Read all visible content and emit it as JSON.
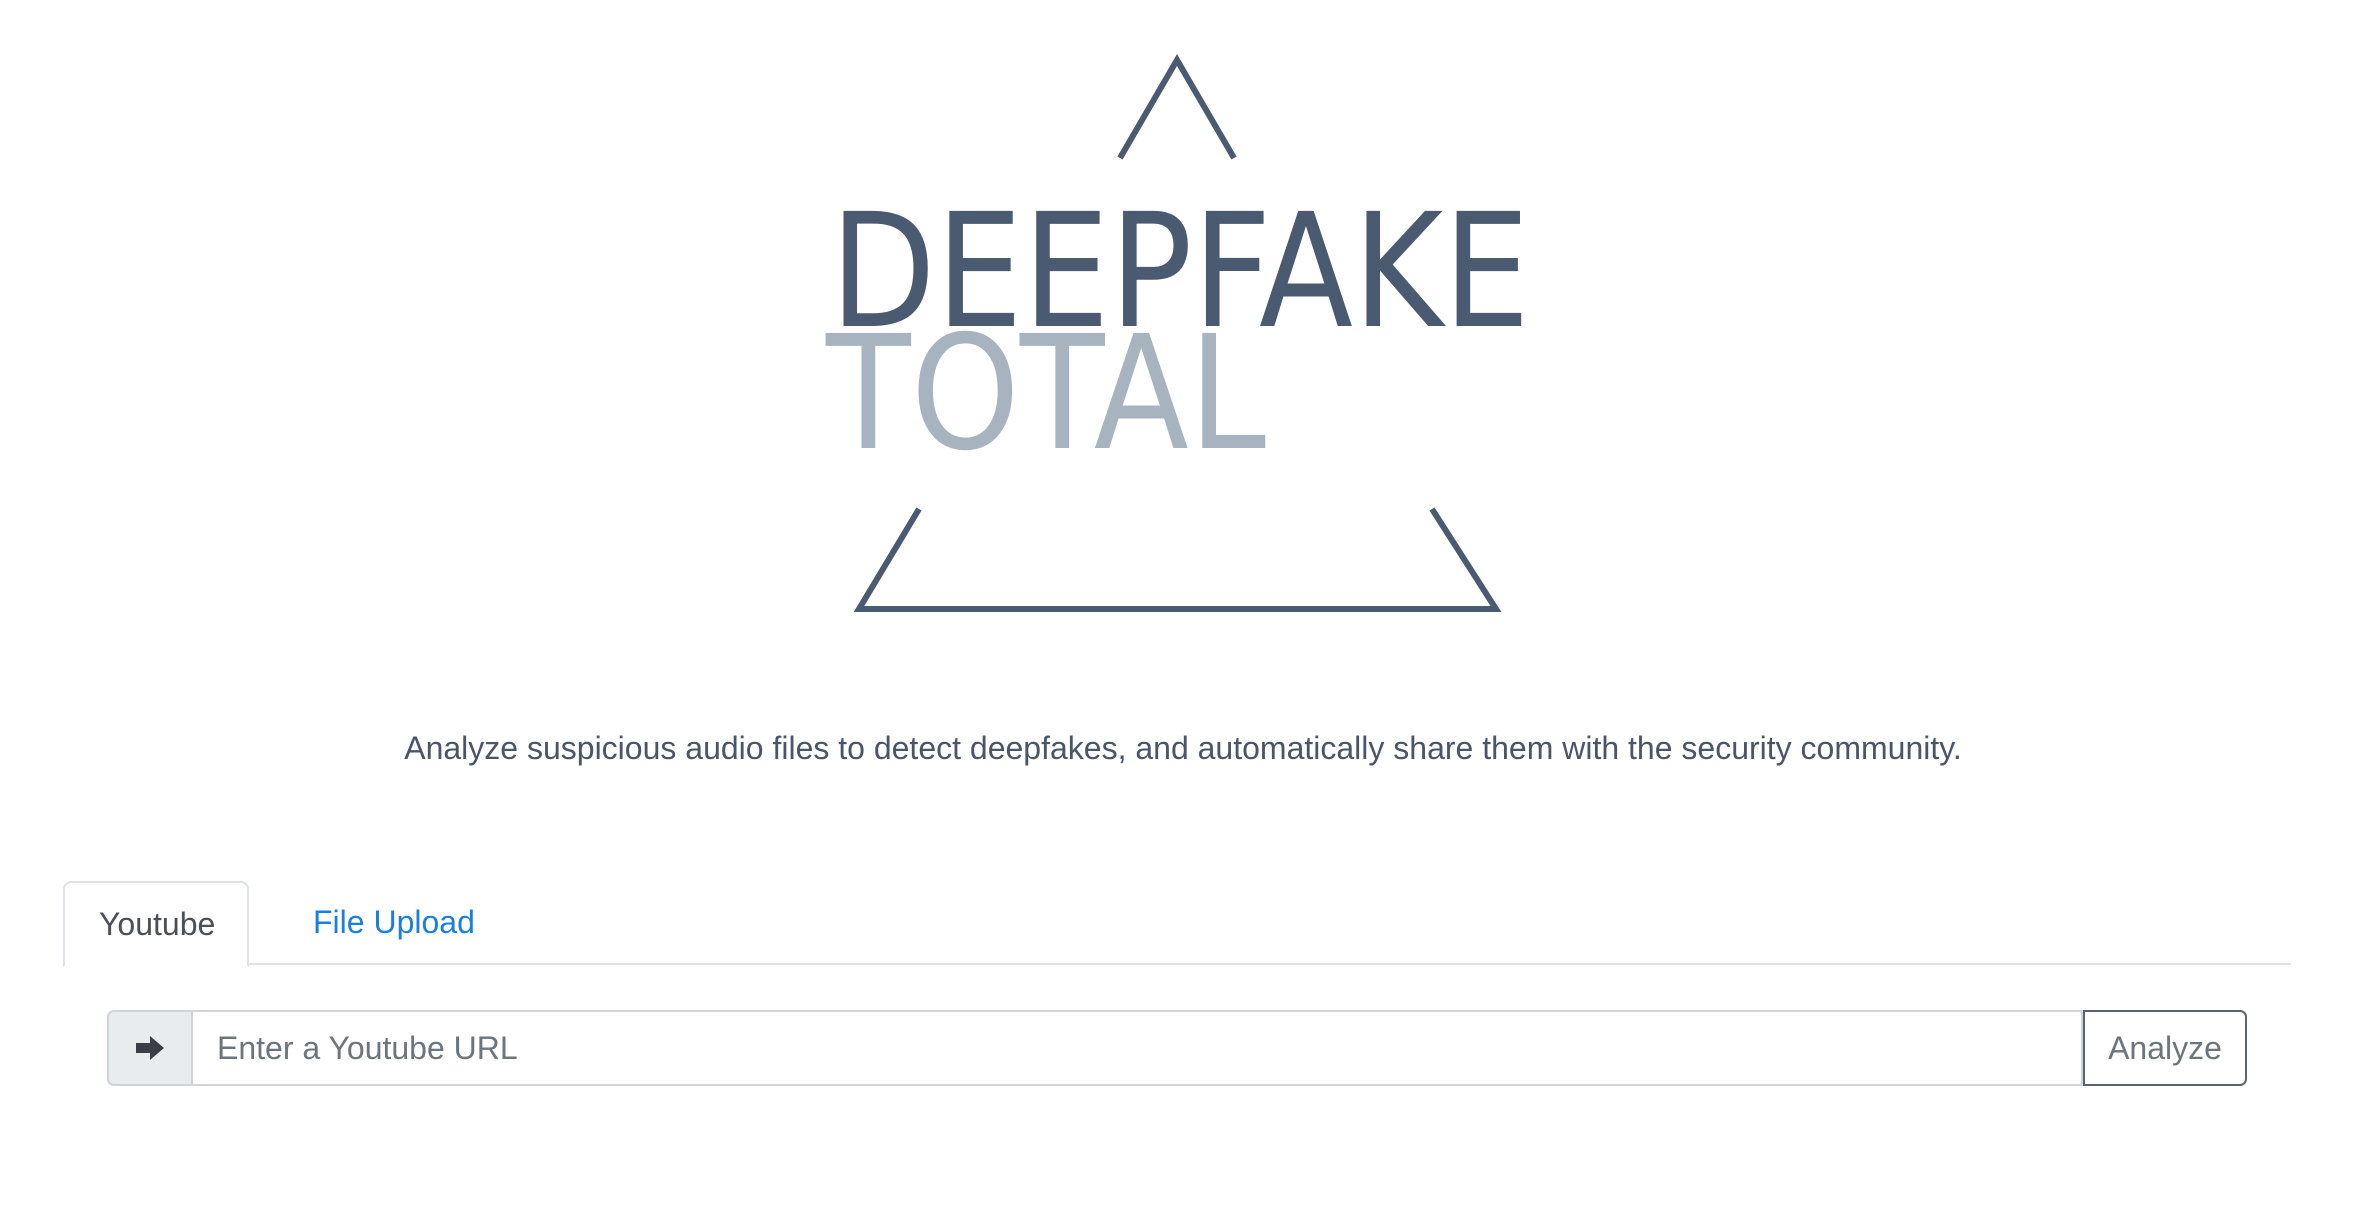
{
  "logo": {
    "word1": "DEEPFAKE",
    "word2": "TOTAL"
  },
  "tagline": "Analyze suspicious audio files to detect deepfakes, and automatically share them with the security community.",
  "tabs": [
    {
      "label": "Youtube",
      "active": true
    },
    {
      "label": "File Upload",
      "active": false
    }
  ],
  "search": {
    "prepend_icon": "arrow-right-icon",
    "placeholder": "Enter a Youtube URL",
    "value": "",
    "button_label": "Analyze"
  },
  "colors": {
    "logo_dark": "#4a5a70",
    "logo_light": "#a7b3be",
    "link": "#1a7fe0",
    "border": "#dee2e6"
  }
}
